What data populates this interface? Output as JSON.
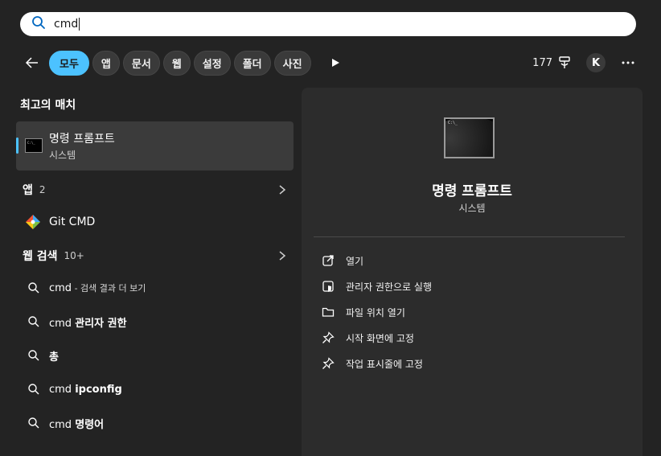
{
  "search": {
    "query": "cmd"
  },
  "filters": {
    "items": [
      "모두",
      "앱",
      "문서",
      "웹",
      "설정",
      "폴더",
      "사진"
    ],
    "points": "177",
    "avatar_initial": "K"
  },
  "best_match": {
    "heading": "최고의 매치",
    "name": "명령 프롬프트",
    "subtitle": "시스템"
  },
  "apps": {
    "heading": "앱",
    "count": "2",
    "items": [
      "Git CMD"
    ]
  },
  "web": {
    "heading": "웹 검색",
    "count": "10+",
    "items": [
      {
        "bold": "cmd",
        "rest": " - 검색 결과 더 보기"
      },
      {
        "prefix": "cmd ",
        "bold": "관리자 권한"
      },
      {
        "bold": "총"
      },
      {
        "prefix": "cmd ",
        "bold": "ipconfig"
      },
      {
        "prefix": "cmd ",
        "bold": "명령어"
      }
    ]
  },
  "preview": {
    "title": "명령 프롬프트",
    "subtitle": "시스템",
    "actions": [
      "열기",
      "관리자 권한으로 실행",
      "파일 위치 열기",
      "시작 화면에 고정",
      "작업 표시줄에 고정"
    ]
  },
  "colors": {
    "accent": "#4cc2ff",
    "background": "#232323",
    "panel": "#2c2c2c",
    "selected": "#3b3b3b"
  }
}
